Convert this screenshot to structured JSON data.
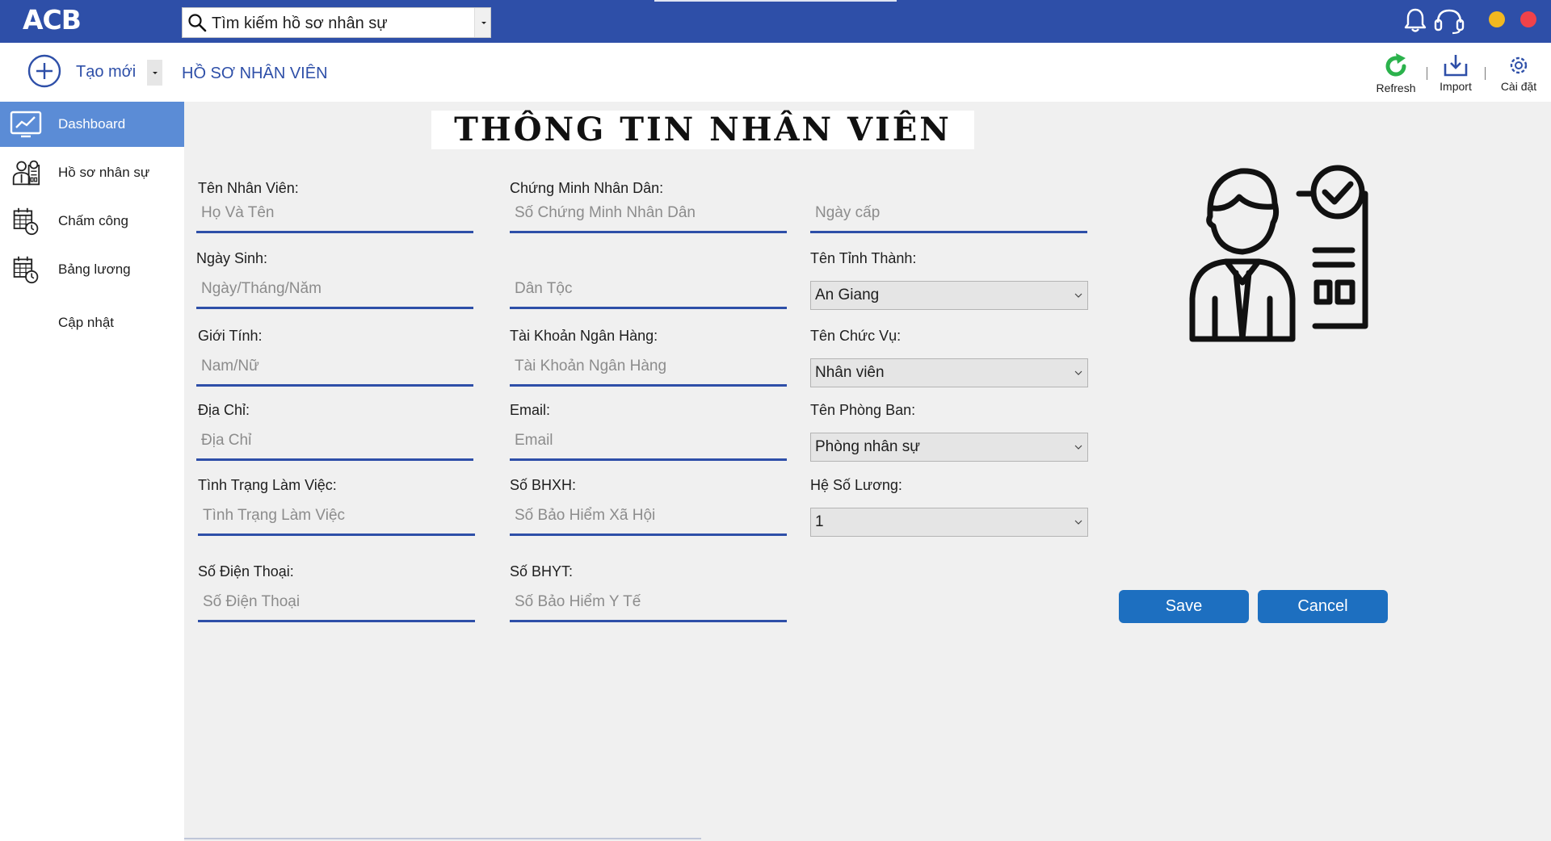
{
  "app": {
    "logo": "ACB"
  },
  "search": {
    "placeholder": "Tìm kiếm hồ sơ nhân sự"
  },
  "toolbar": {
    "new_label": "Tạo mới",
    "breadcrumb": "HỒ SƠ NHÂN VIÊN",
    "refresh_label": "Refresh",
    "import_label": "Import",
    "settings_label": "Cài đặt"
  },
  "sidebar": {
    "items": [
      {
        "label": "Dashboard",
        "icon": "dashboard-chart-icon",
        "active": true
      },
      {
        "label": "Hồ sơ nhân sự",
        "icon": "employees-icon",
        "active": false
      },
      {
        "label": "Chấm công",
        "icon": "calendar-clock-icon",
        "active": false
      },
      {
        "label": "Bảng lương",
        "icon": "calendar-clock-icon",
        "active": false
      },
      {
        "label": "Cập nhật",
        "icon": "",
        "active": false
      }
    ]
  },
  "form": {
    "title": "THÔNG TIN NHÂN VIÊN",
    "labels": {
      "employee_name": "Tên Nhân Viên:",
      "id_card": "Chứng Minh Nhân Dân:",
      "birth_date": "Ngày Sinh:",
      "province": "Tên Tỉnh Thành:",
      "gender": "Giới Tính:",
      "bank_account": "Tài Khoản Ngân Hàng:",
      "position": "Tên Chức Vụ:",
      "address": "Địa Chỉ:",
      "email": "Email:",
      "department": "Tên Phòng Ban:",
      "work_status": "Tình Trạng Làm Việc:",
      "social_insurance": "Số BHXH:",
      "salary_coefficient": "Hệ Số Lương:",
      "phone": "Số Điện Thoại:",
      "health_insurance": "Số BHYT:"
    },
    "placeholders": {
      "employee_name": "Họ Và Tên",
      "id_card": "Số Chứng Minh Nhân Dân",
      "issue_date": "Ngày cấp",
      "birth_date": "Ngày/Tháng/Năm",
      "ethnicity": "Dân Tộc",
      "gender": "Nam/Nữ",
      "bank_account": "Tài Khoản Ngân Hàng",
      "address": "Địa Chỉ",
      "email": "Email",
      "work_status": "Tình Trạng Làm Việc",
      "social_insurance": "Số Bảo Hiểm Xã Hội",
      "phone": "Số Điện Thoại",
      "health_insurance": "Số Bảo Hiểm Y Tế"
    },
    "selects": {
      "province": "An Giang",
      "position": "Nhân viên",
      "department": "Phòng nhân sự",
      "salary_coefficient": "1"
    },
    "buttons": {
      "save": "Save",
      "cancel": "Cancel"
    }
  },
  "colors": {
    "primary": "#2e4fa8",
    "sidebar_active": "#5b8cd6",
    "button": "#1d6fc0",
    "content_bg": "#f0f0f0",
    "yellow_dot": "#f2b81f",
    "red_dot": "#f0424a",
    "refresh_green": "#2bb24c"
  }
}
